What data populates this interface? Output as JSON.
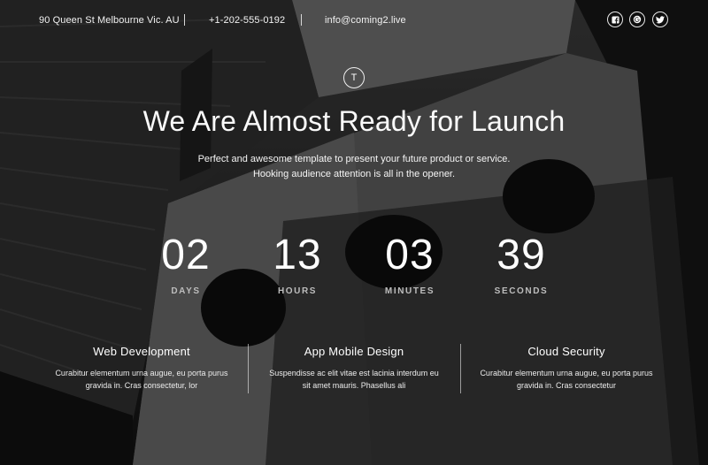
{
  "topbar": {
    "address": "90 Queen St Melbourne Vic. AU",
    "phone": "+1-202-555-0192",
    "email": "info@coming2.live",
    "social": [
      {
        "icon": "facebook-icon"
      },
      {
        "icon": "google-plus-icon"
      },
      {
        "icon": "twitter-icon"
      }
    ]
  },
  "logo": {
    "letter": "T"
  },
  "hero": {
    "title": "We Are Almost Ready for Launch",
    "subtitle_line1": "Perfect and awesome template to present your future product or service.",
    "subtitle_line2": "Hooking audience attention is all in the opener."
  },
  "countdown": {
    "days": {
      "value": "02",
      "label": "DAYS"
    },
    "hours": {
      "value": "13",
      "label": "HOURS"
    },
    "minutes": {
      "value": "03",
      "label": "MINUTES"
    },
    "seconds": {
      "value": "39",
      "label": "SECONDS"
    }
  },
  "features": [
    {
      "title": "Web Development",
      "desc": "Curabitur elementum urna augue, eu porta purus gravida in. Cras consectetur, lor"
    },
    {
      "title": "App Mobile Design",
      "desc": "Suspendisse ac elit vitae est lacinia interdum eu sit amet mauris. Phasellus ali"
    },
    {
      "title": "Cloud Security",
      "desc": "Curabitur elementum urna augue, eu porta purus gravida in. Cras consectetur"
    }
  ],
  "colors": {
    "text": "#ffffff",
    "label": "#bdbdbd",
    "background": "#1a1a1a"
  }
}
